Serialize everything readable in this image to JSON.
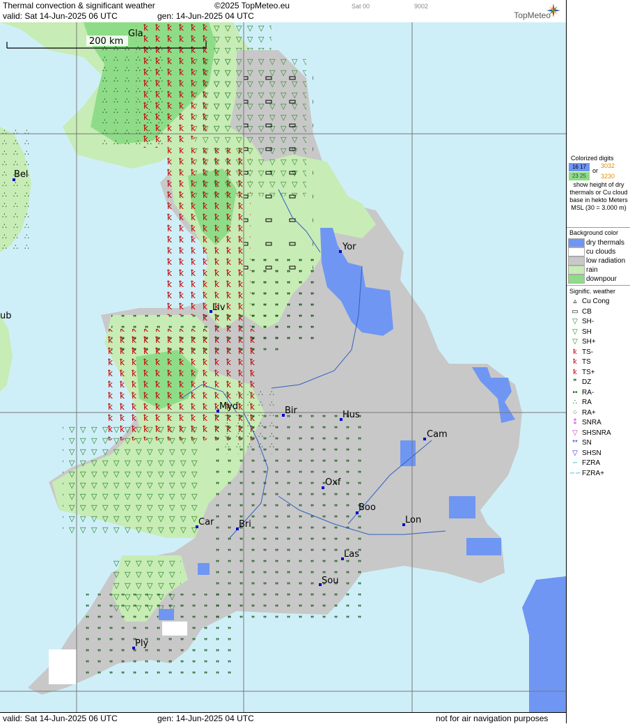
{
  "header": {
    "title": "Thermal convection & significant weather",
    "copyright": "©2025 TopMeteo.eu",
    "valid_line": "valid:  Sat  14-Jun-2025  06 UTC",
    "gen_line": "gen: 14-Jun-2025 04 UTC",
    "code1": "Sat 00",
    "code2": "9002",
    "brand": "TopMeteo"
  },
  "footer": {
    "valid_line": "valid:  Sat  14-Jun-2025  06 UTC",
    "gen_line": "gen: 14-Jun-2025 04 UTC",
    "disclaimer": "not for air navigation purposes"
  },
  "scale": {
    "label": "200 km"
  },
  "legend": {
    "digits_title": "Colorized digits",
    "digit_sample1": "16 17",
    "digit_sample2": "23 25",
    "digit_or": "or",
    "digit_sample3": "3032",
    "digit_sample4": "3230",
    "digits_desc": "show height of dry thermals or Cu cloud base in hekto Meters MSL (30 = 3.000 m)",
    "background_title": "Background color",
    "background_items": [
      {
        "label": "dry thermals",
        "color": "#6f96f2"
      },
      {
        "label": "cu clouds",
        "color": "#ffffff"
      },
      {
        "label": "low radiation",
        "color": "#c8c8c8"
      },
      {
        "label": "rain",
        "color": "#c7ecb5"
      },
      {
        "label": "downpour",
        "color": "#8fdc88"
      }
    ],
    "weather_title": "Signific. weather",
    "weather_items": [
      {
        "label": "Cu Cong",
        "symbol": "▵",
        "color": "#000000"
      },
      {
        "label": "CB",
        "symbol": "▭",
        "color": "#000000"
      },
      {
        "label": "SH-",
        "symbol": "▽",
        "color": "#1a8a1a"
      },
      {
        "label": "SH",
        "symbol": "▽",
        "color": "#1a8a1a"
      },
      {
        "label": "SH+",
        "symbol": "▽",
        "color": "#1a8a1a"
      },
      {
        "label": "TS-",
        "symbol": "ꝁ",
        "color": "#cc0000"
      },
      {
        "label": "TS",
        "symbol": "ꝁ",
        "color": "#cc0000"
      },
      {
        "label": "TS+",
        "symbol": "ꝁ",
        "color": "#cc0000"
      },
      {
        "label": "DZ",
        "symbol": "❞",
        "color": "#1a6a1a"
      },
      {
        "label": "RA-",
        "symbol": "••",
        "color": "#1a6a1a"
      },
      {
        "label": "RA",
        "symbol": "∴",
        "color": "#1a6a1a"
      },
      {
        "label": "RA+",
        "symbol": "⁘",
        "color": "#1a6a1a"
      },
      {
        "label": "SNRA",
        "symbol": "⁑",
        "color": "#cc33cc"
      },
      {
        "label": "SHSNRA",
        "symbol": "▽",
        "color": "#cc33cc"
      },
      {
        "label": "SN",
        "symbol": "**",
        "color": "#3333cc"
      },
      {
        "label": "SHSN",
        "symbol": "▽",
        "color": "#3333cc"
      },
      {
        "label": "FZRA",
        "symbol": "∽",
        "color": "#22bbcc"
      },
      {
        "label": "FZRA+",
        "symbol": "∽∽",
        "color": "#22bbcc"
      }
    ]
  },
  "cities": [
    {
      "name": "Gla"
    },
    {
      "name": "Bel"
    },
    {
      "name": "ub"
    },
    {
      "name": "Yor"
    },
    {
      "name": "Liv"
    },
    {
      "name": "Myd"
    },
    {
      "name": "Bir"
    },
    {
      "name": "Hus"
    },
    {
      "name": "Cam"
    },
    {
      "name": "Oxf"
    },
    {
      "name": "Boo"
    },
    {
      "name": "Lon"
    },
    {
      "name": "Car"
    },
    {
      "name": "Bri"
    },
    {
      "name": "Las"
    },
    {
      "name": "Sou"
    },
    {
      "name": "Ply"
    }
  ]
}
